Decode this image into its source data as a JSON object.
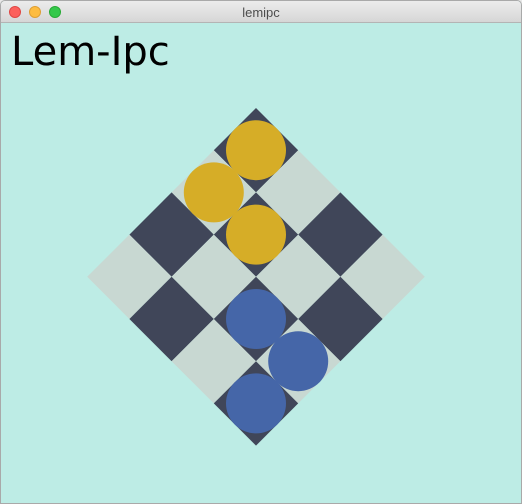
{
  "window": {
    "title": "lemipc"
  },
  "app": {
    "heading": "Lem-Ipc"
  },
  "board": {
    "rows": 4,
    "cols": 4,
    "colors": {
      "dark_cell": "#404659",
      "light_cell": "#c8d8d2",
      "team_yellow": "#d6ad27",
      "team_blue": "#4566a8"
    },
    "cells": [
      [
        "dark",
        "light",
        "dark",
        "light"
      ],
      [
        "light",
        "dark",
        "light",
        "dark"
      ],
      [
        "dark",
        "light",
        "dark",
        "light"
      ],
      [
        "light",
        "dark",
        "light",
        "dark"
      ]
    ],
    "players": [
      {
        "team": "yellow",
        "row": 0,
        "col": 0
      },
      {
        "team": "yellow",
        "row": 1,
        "col": 0
      },
      {
        "team": "yellow",
        "row": 1,
        "col": 1
      },
      {
        "team": "blue",
        "row": 2,
        "col": 2
      },
      {
        "team": "blue",
        "row": 2,
        "col": 3
      },
      {
        "team": "blue",
        "row": 3,
        "col": 3
      }
    ]
  }
}
